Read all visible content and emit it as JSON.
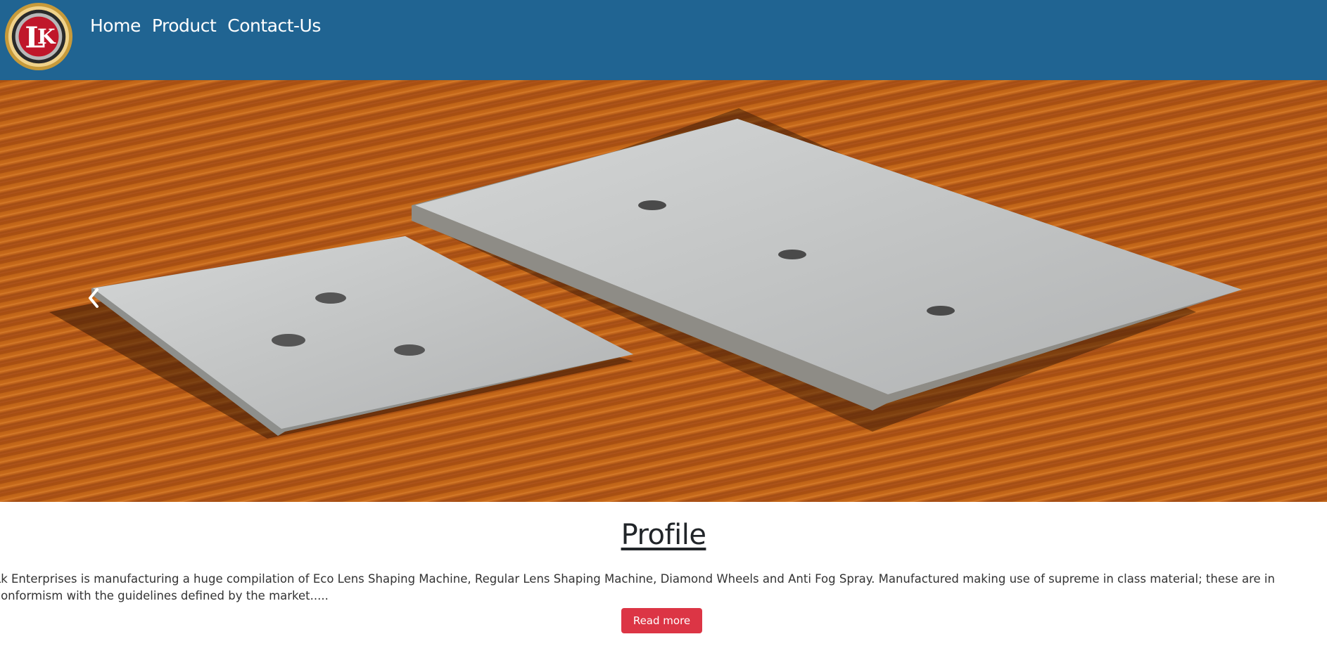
{
  "nav": {
    "logo_icon": "lk-enterprises-logo",
    "links": [
      "Home",
      "Product",
      "Contact-Us"
    ]
  },
  "hero": {
    "image": "aluminium-plates-on-wooden-table",
    "prev_icon": "chevron-left-icon"
  },
  "profile": {
    "title": "Profile",
    "text": "Lk Enterprises is manufacturing a huge compilation of Eco Lens Shaping Machine, Regular Lens Shaping Machine, Diamond Wheels and Anti Fog Spray. Manufactured making use of supreme in class material; these are in conformism with the guidelines defined by the market.....",
    "button": "Read more"
  },
  "colors": {
    "navbar": "#206492",
    "button": "#dc3545"
  }
}
